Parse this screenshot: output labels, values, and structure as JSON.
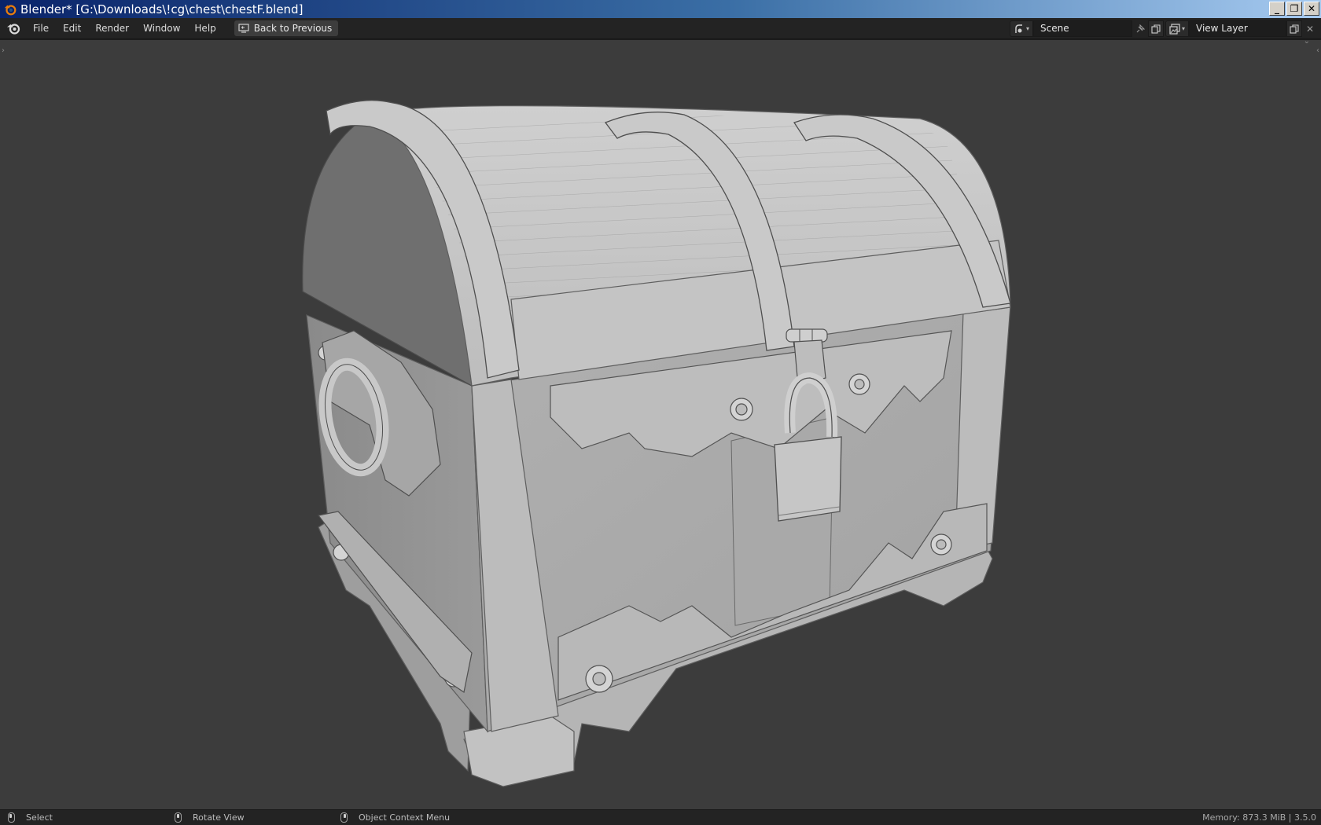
{
  "window": {
    "title": "Blender* [G:\\Downloads\\!cg\\chest\\chestF.blend]",
    "controls": [
      "minimize",
      "restore",
      "close"
    ]
  },
  "topbar": {
    "menus": [
      "File",
      "Edit",
      "Render",
      "Window",
      "Help"
    ],
    "back_button_label": "Back to Previous",
    "scene": {
      "name": "Scene"
    },
    "view_layer": {
      "name": "View Layer"
    }
  },
  "statusbar": {
    "select_label": "Select",
    "rotate_label": "Rotate View",
    "context_menu_label": "Object Context Menu",
    "memory_label": "Memory: 873.3 MiB | 3.5.0"
  },
  "viewport": {
    "content": "treasure-chest-model",
    "background_color": "#3c3c3c",
    "mesh_color": "#b9b9b9"
  },
  "icons": {
    "app": "blender-logo-icon",
    "back": "screen-back-icon",
    "scene": "scene-icon",
    "pin": "pin-icon",
    "duplicate": "duplicate-icon",
    "close": "close-icon",
    "view_layer": "view-layer-icon"
  }
}
